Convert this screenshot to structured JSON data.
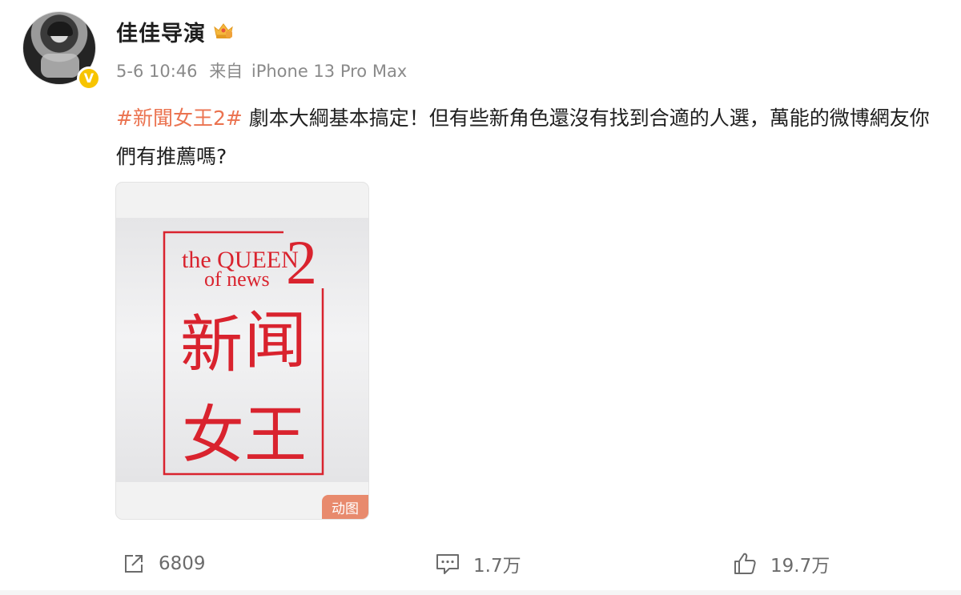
{
  "post": {
    "username": "佳佳导演",
    "timestamp": "5-6 10:46",
    "source_prefix": "来自",
    "source_device": "iPhone 13 Pro Max",
    "verified_badge": "V",
    "hashtag": "#新聞女王2#",
    "body": " 劇本大綱基本搞定！但有些新角色還沒有找到合適的人選，萬能的微博網友你們有推薦嗎?",
    "media": {
      "gif_badge": "动图",
      "poster_title_line1": "the QUEEN",
      "poster_title_line2": "of news",
      "poster_number": "2",
      "poster_chars": [
        "新",
        "闻",
        "女",
        "王"
      ]
    }
  },
  "actions": {
    "share_count": "6809",
    "comment_count": "1.7万",
    "like_count": "19.7万"
  },
  "colors": {
    "hashtag": "#eb7350",
    "poster_red": "#d9232e",
    "verified": "#f7c400",
    "gif_badge": "#e88a6d"
  },
  "icons": [
    "vip-crown-icon",
    "share-icon",
    "comment-icon",
    "like-icon"
  ]
}
